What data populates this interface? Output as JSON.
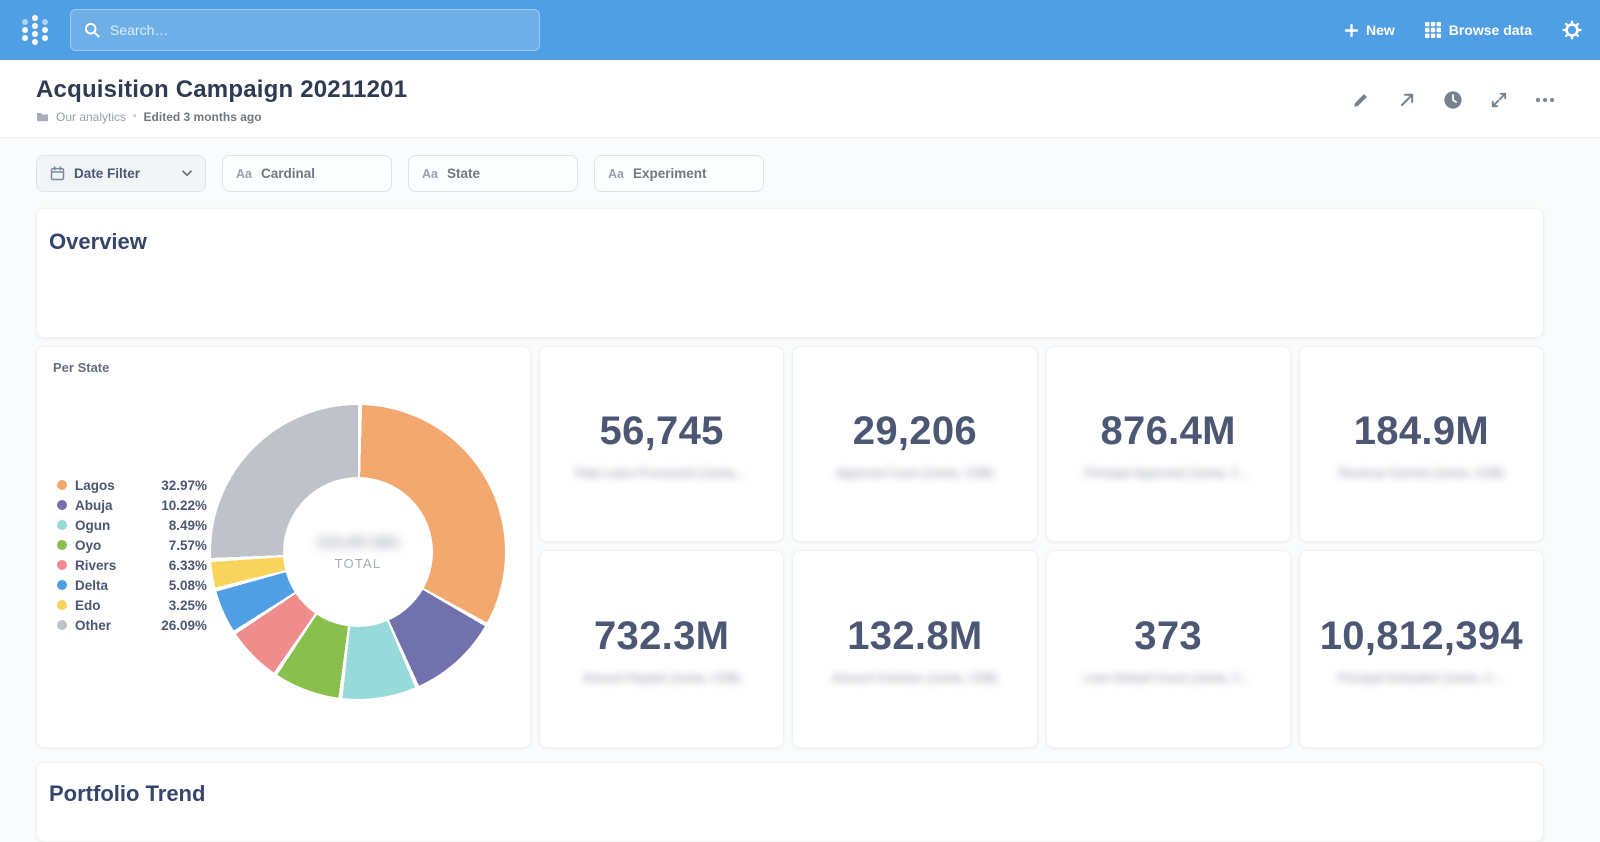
{
  "topbar": {
    "search_placeholder": "Search…",
    "new_label": "New",
    "browse_label": "Browse data"
  },
  "header": {
    "title": "Acquisition Campaign 20211201",
    "collection": "Our analytics",
    "separator": "•",
    "edited": "Edited 3 months ago"
  },
  "filters": {
    "date": {
      "label": "Date Filter"
    },
    "cardinal": {
      "prefix": "Aa",
      "label": "Cardinal"
    },
    "state": {
      "prefix": "Aa",
      "label": "State"
    },
    "experiment": {
      "prefix": "Aa",
      "label": "Experiment"
    }
  },
  "overview": {
    "title": "Overview"
  },
  "portfolio": {
    "title": "Portfolio Trend"
  },
  "chart_data": {
    "type": "pie",
    "title": "Per State",
    "donut": true,
    "legend_position": "left",
    "categories": [
      "Lagos",
      "Abuja",
      "Ogun",
      "Oyo",
      "Rivers",
      "Delta",
      "Edo",
      "Other"
    ],
    "values": [
      32.97,
      10.22,
      8.49,
      7.57,
      6.33,
      5.08,
      3.25,
      26.09
    ],
    "percent_labels": [
      "32.97%",
      "10.22%",
      "8.49%",
      "7.57%",
      "6.33%",
      "5.08%",
      "3.25%",
      "26.09%"
    ],
    "colors": [
      "#F2A86F",
      "#7172AD",
      "#98D9D9",
      "#88BF4D",
      "#EF8C8C",
      "#509EE3",
      "#F9D45C",
      "#BFC3C9"
    ],
    "center": {
      "value_obscured": "123,457,891",
      "label": "TOTAL"
    }
  },
  "scalar_cards": [
    {
      "value": "56,745",
      "caption": "Total Loans Processed (Jumia,…"
    },
    {
      "value": "29,206",
      "caption": "Approval Count (Jumia, CDB)"
    },
    {
      "value": "876.4M",
      "caption": "Principal Approved (Jumia, C…"
    },
    {
      "value": "184.9M",
      "caption": "Revenue Earned (Jumia, CDB)"
    },
    {
      "value": "732.3M",
      "caption": "Amount Repaid (Jumia, CDB)"
    },
    {
      "value": "132.8M",
      "caption": "Amount Overdue (Jumia, CDB)"
    },
    {
      "value": "373",
      "caption": "Loan Default Count (Jumia, C…"
    },
    {
      "value": "10,812,394",
      "caption": "Principal Defaulted (Jumia, C…"
    }
  ]
}
